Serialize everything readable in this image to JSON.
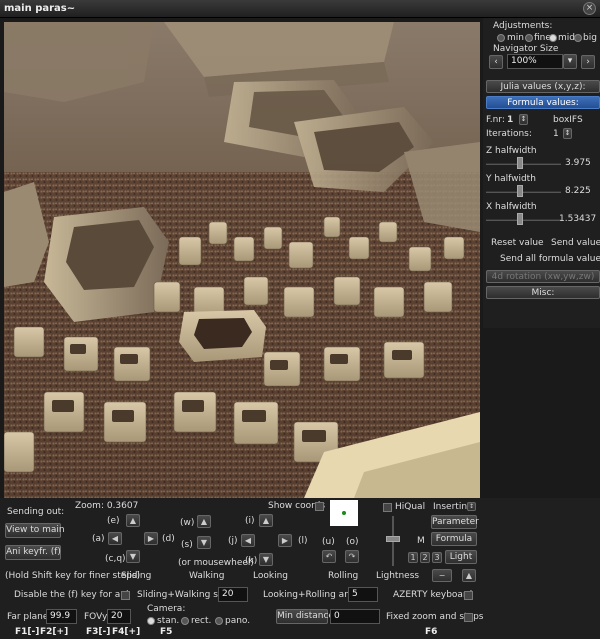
{
  "window": {
    "title": "main paras~",
    "close_glyph": "×"
  },
  "adjustments": {
    "label": "Adjustments:",
    "radios": [
      {
        "label": "min",
        "selected": false
      },
      {
        "label": "fine",
        "selected": false
      },
      {
        "label": "mid",
        "selected": true
      },
      {
        "label": "big",
        "selected": false
      }
    ],
    "navigator_size_label": "Navigator Size",
    "navigator_size_value": "100%"
  },
  "formula_panel": {
    "julia_button": "Julia values (x,y,z):",
    "formula_button": "Formula values:",
    "fnr_label": "F.nr:",
    "fnr_value": "1",
    "formula_name": "boxIFS",
    "iterations_label": "Iterations:",
    "iterations_value": "1",
    "z_label": "Z halfwidth",
    "z_value": "3.975",
    "y_label": "Y halfwidth",
    "y_value": "8.225",
    "x_label": "X halfwidth",
    "x_value": "1.53437",
    "reset_value": "Reset value",
    "send_value": "Send value",
    "send_all": "Send all formula values",
    "rotation_button": "4d rotation (xw,yw,zw)",
    "misc_button": "Misc:"
  },
  "nav": {
    "sending_out": "Sending out:",
    "zoom": "Zoom: 0.3607",
    "show_coords": "Show coords",
    "hiqual": "HiQual",
    "inserting": "Inserting:",
    "view_to_main": "View to main",
    "ani_keyfr": "Ani keyfr. (f)",
    "hold_shift": "(Hold Shift key for finer steps)",
    "sliding": "Sliding",
    "walking": "Walking",
    "looking": "Looking",
    "rolling": "Rolling",
    "lightness": "Lightness",
    "or_mousewheel": "(or mousewheel)",
    "keys": {
      "e": "(e)",
      "a": "(a)",
      "d": "(d)",
      "cq": "(c,q)",
      "w": "(w)",
      "s": "(s)",
      "i": "(i)",
      "j": "(j)",
      "l": "(l)",
      "k": "(k)",
      "u": "(u)",
      "o": "(o)"
    },
    "parameter": "Parameter",
    "formula": "Formula",
    "light": "Light",
    "m_label": "M",
    "light_nums": [
      "1",
      "2",
      "3"
    ],
    "disable_f": "Disable the (f) key for ani",
    "sliding_walking_step_label": "Sliding+Walking step:",
    "sliding_walking_step_value": "20",
    "looking_rolling_label": "Looking+Rolling angle:",
    "looking_rolling_value": "5",
    "azerty": "AZERTY keyboard",
    "far_plane_label": "Far plane:",
    "far_plane_value": "99.9",
    "fovy_label": "FOVy:",
    "fovy_value": "20",
    "camera_label": "Camera:",
    "camera_options": [
      {
        "label": "stan.",
        "selected": true
      },
      {
        "label": "rect.",
        "selected": false
      },
      {
        "label": "pano.",
        "selected": false
      }
    ],
    "min_distance_label": "Min distance:",
    "min_distance_value": "0",
    "fixed_zoom": "Fixed zoom and steps"
  },
  "fkeys": {
    "f1": "F1[-]",
    "f2": "F2[+]",
    "f3": "F3[-]",
    "f4": "F4[+]",
    "f5": "F5",
    "f6": "F6"
  },
  "colors": {
    "accent_blue": "#3d6fb8",
    "background": "#1f1f1f"
  }
}
